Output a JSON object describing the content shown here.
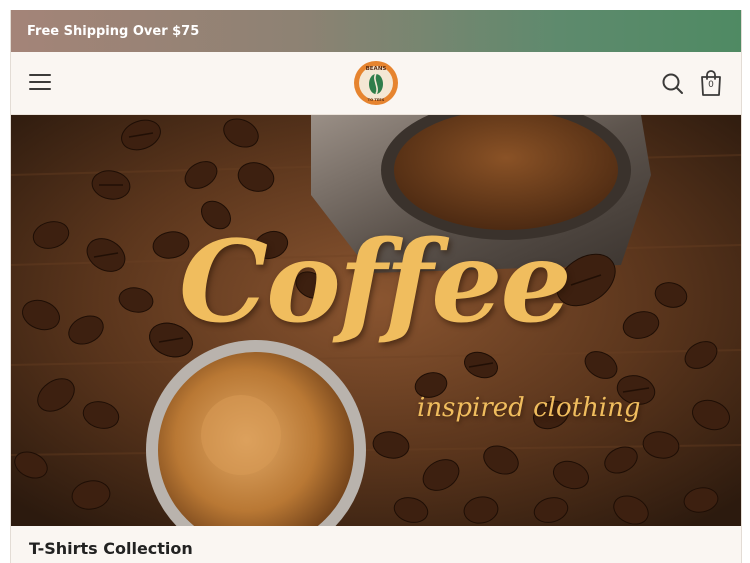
{
  "announcement": {
    "text": "Free Shipping Over $75"
  },
  "header": {
    "menu_icon": "hamburger-menu-icon",
    "logo_icon": "beans-to-tees-coffee-bean-logo",
    "logo_text_top": "BEANS",
    "logo_text_bottom": "TO TEES",
    "search_icon": "search-icon",
    "cart_icon": "shopping-bag-icon",
    "cart_count": "0"
  },
  "hero": {
    "title": "Coffee",
    "subtitle": "inspired clothing"
  },
  "collection": {
    "title": "T-Shirts Collection"
  },
  "colors": {
    "announcement_gradient_start": "#a48478",
    "announcement_gradient_end": "#4f8a63",
    "header_background": "#faf6f2",
    "hero_text": "#f0bd5e",
    "logo_ring": "#e6842f",
    "logo_bean": "#2f7d4a"
  }
}
